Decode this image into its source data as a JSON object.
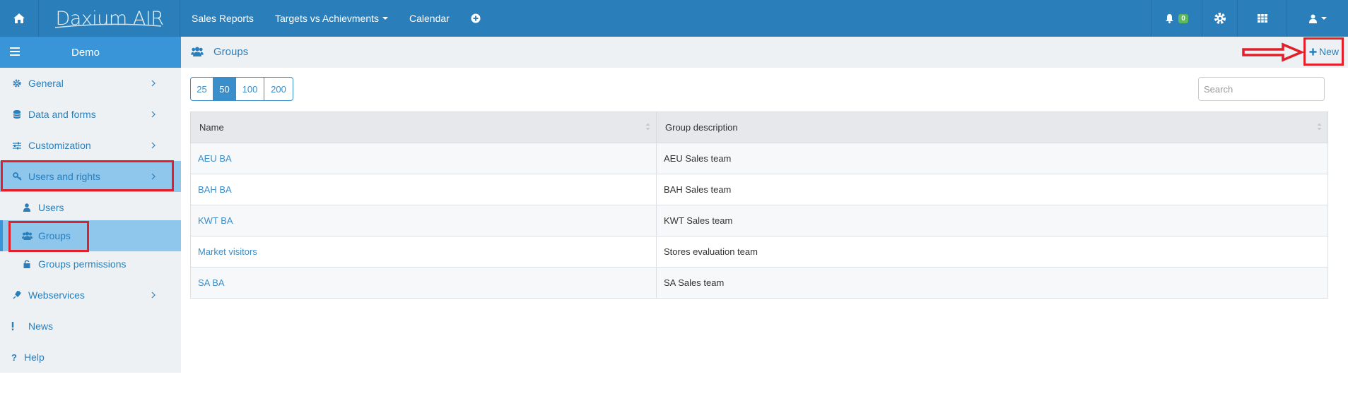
{
  "topbar": {
    "logo_text": "Daxium AIR",
    "nav": [
      {
        "label": "Sales Reports"
      },
      {
        "label": "Targets vs Achievments",
        "has_dropdown": true
      },
      {
        "label": "Calendar"
      }
    ],
    "notification_count": "0"
  },
  "sidebar": {
    "title": "Demo",
    "items": [
      {
        "label": "General",
        "icon": "gear-icon"
      },
      {
        "label": "Data and forms",
        "icon": "database-icon"
      },
      {
        "label": "Customization",
        "icon": "sliders-icon"
      },
      {
        "label": "Users and rights",
        "icon": "key-icon"
      },
      {
        "label": "Users",
        "icon": "user-icon"
      },
      {
        "label": "Groups",
        "icon": "users-icon"
      },
      {
        "label": "Groups permissions",
        "icon": "unlock-icon"
      },
      {
        "label": "Webservices",
        "icon": "plug-icon"
      },
      {
        "label": "News",
        "icon": "exclamation-icon"
      },
      {
        "label": "Help",
        "icon": "question-icon"
      }
    ]
  },
  "page": {
    "title": "Groups",
    "new_label": "New"
  },
  "pager": {
    "options": [
      "25",
      "50",
      "100",
      "200"
    ],
    "selected": "50"
  },
  "search": {
    "placeholder": "Search"
  },
  "table": {
    "headers": [
      "Name",
      "Group description"
    ],
    "rows": [
      {
        "name": "AEU BA",
        "description": "AEU Sales team"
      },
      {
        "name": "BAH BA",
        "description": "BAH Sales team"
      },
      {
        "name": "KWT BA",
        "description": "KWT Sales team"
      },
      {
        "name": "Market visitors",
        "description": "Stores evaluation team"
      },
      {
        "name": "SA BA",
        "description": "SA Sales team"
      }
    ]
  },
  "colors": {
    "topbar": "#2a7fbb",
    "sidebar_head": "#3a95d8",
    "active_item": "#8ec6ec",
    "annotation": "#e1202a"
  }
}
